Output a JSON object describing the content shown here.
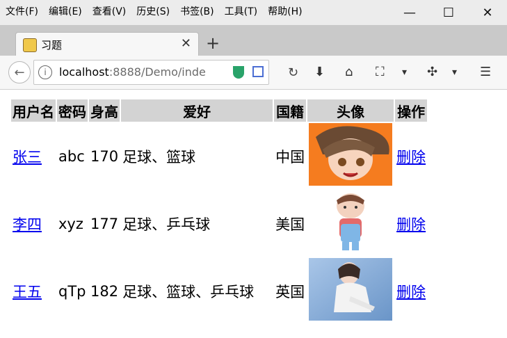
{
  "menu": [
    "文件(F)",
    "编辑(E)",
    "查看(V)",
    "历史(S)",
    "书签(B)",
    "工具(T)",
    "帮助(H)"
  ],
  "window_controls": {
    "minimize": "—",
    "maximize": "☐",
    "close": "✕"
  },
  "tab": {
    "title": "习题",
    "close": "✕",
    "new": "+"
  },
  "toolbar": {
    "back": "←",
    "info": "i",
    "url_host": "localhost",
    "url_rest": ":8888/Demo/inde",
    "reload": "↻",
    "download": "⬇",
    "home": "⌂",
    "crop": "⛶",
    "dropdown": "▾",
    "plugin": "✣",
    "menu": "☰"
  },
  "table": {
    "headers": [
      "用户名",
      "密码",
      "身高",
      "爱好",
      "国籍",
      "头像",
      "操作"
    ],
    "rows": [
      {
        "name": "张三",
        "password": "abc",
        "height": "170",
        "hobby": "足球、篮球",
        "country": "中国",
        "action": "删除"
      },
      {
        "name": "李四",
        "password": "xyz",
        "height": "177",
        "hobby": "足球、乒乓球",
        "country": "美国",
        "action": "删除"
      },
      {
        "name": "王五",
        "password": "qTp",
        "height": "182",
        "hobby": "足球、篮球、乒乓球",
        "country": "英国",
        "action": "删除"
      }
    ]
  },
  "colors": {
    "header_bg": "#d3d3d3",
    "link": "#0000ee"
  }
}
